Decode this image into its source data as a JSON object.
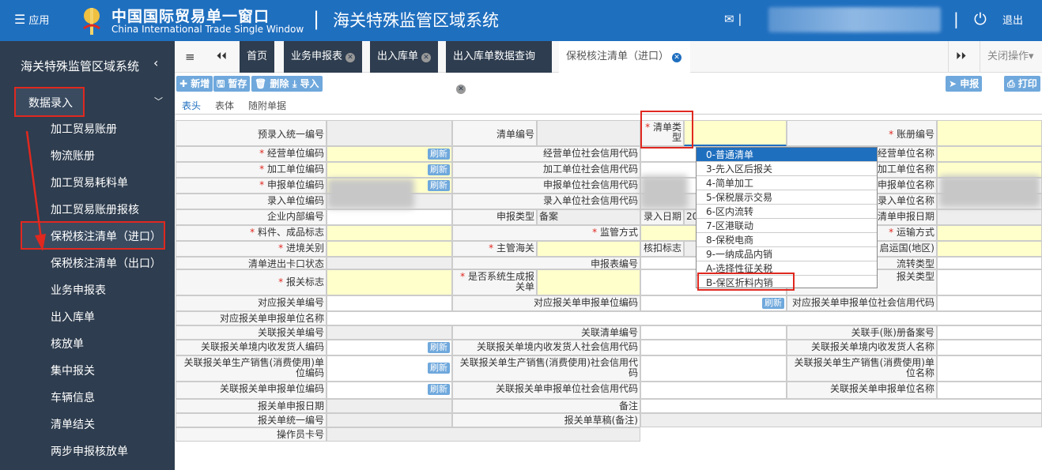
{
  "header": {
    "apps_label": "应用",
    "brand_cn": "中国国际贸易单一窗口",
    "brand_en": "China International Trade Single Window",
    "system_title": "海关特殊监管区域系统",
    "logout": "退出"
  },
  "sidebar": {
    "title": "海关特殊监管区域系统",
    "group": "数据录入",
    "items": [
      "加工贸易账册",
      "物流账册",
      "加工贸易耗料单",
      "加工贸易账册报核",
      "保税核注清单（进口）",
      "保税核注清单（出口）",
      "业务申报表",
      "出入库单",
      "核放单",
      "集中报关",
      "车辆信息",
      "清单结关",
      "两步申报核放单"
    ]
  },
  "tabs": [
    {
      "label": "首页"
    },
    {
      "label": "业务申报表"
    },
    {
      "label": "出入库单"
    },
    {
      "label": "出入库单数据查询"
    },
    {
      "label": "保税核注清单（进口）"
    }
  ],
  "tab_actions": "关闭操作",
  "toolbar": {
    "add": "新增",
    "save": "暂存",
    "delete": "删除",
    "import": "导入",
    "declare": "申报",
    "print": "打印"
  },
  "subtabs": [
    "表头",
    "表体",
    "随附单据"
  ],
  "form": {
    "refresh": "刷新",
    "labels": {
      "pre_entry_no": "预录入统一编号",
      "list_no": "清单编号",
      "list_type": "清单类型",
      "book_no": "账册编号",
      "op_code": "经营单位编码",
      "op_credit": "经营单位社会信用代码",
      "op_name": "经营单位名称",
      "proc_code": "加工单位编码",
      "proc_credit": "加工单位社会信用代码",
      "proc_name": "加工单位名称",
      "decl_code": "申报单位编码",
      "decl_credit": "申报单位社会信用代码",
      "decl_name": "申报单位名称",
      "entry_code": "录入单位编码",
      "entry_credit": "录入单位社会信用代码",
      "entry_name": "录入单位名称",
      "inner_no": "企业内部编号",
      "decl_type": "申报类型",
      "entry_date": "录入日期",
      "list_decl_date": "清单申报日期",
      "material_flag": "料件、成品标志",
      "supervision": "监管方式",
      "transport": "运输方式",
      "port": "进境关别",
      "customs": "主管海关",
      "deduct_flag": "核扣标志",
      "origin": "启运国(地区)",
      "gate_status": "清单进出卡口状态",
      "form_no": "申报表编号",
      "flow_type": "流转类型",
      "decl_flag": "报关标志",
      "sys_gen": "是否系统生成报关单",
      "decl_kind": "报关类型",
      "cd_no": "对应报关单编号",
      "cd_decl_code": "对应报关单申报单位编码",
      "cd_decl_credit": "对应报关单申报单位社会信用代码",
      "cd_decl_name": "对应报关单申报单位名称",
      "rel_cd_no": "关联报关单编号",
      "rel_list_no": "关联清单编号",
      "rel_book_no": "关联手(账)册备案号",
      "rel_recv_code": "关联报关单境内收发货人编码",
      "rel_recv_credit": "关联报关单境内收发货人社会信用代码",
      "rel_recv_name": "关联报关单境内收发货人名称",
      "rel_prod_code": "关联报关单生产销售(消费使用)单位编码",
      "rel_prod_credit": "关联报关单生产销售(消费使用)社会信用代码",
      "rel_prod_name": "关联报关单生产销售(消费使用)单位名称",
      "rel_decl_code": "关联报关单申报单位编码",
      "rel_decl_credit": "关联报关单申报单位社会信用代码",
      "rel_decl_name": "关联报关单申报单位名称",
      "cd_decl_date": "报关单申报日期",
      "remark": "备注",
      "cd_unified_no": "报关单统一编号",
      "cd_draft": "报关单草稿(备注)",
      "operator_card": "操作员卡号"
    },
    "values": {
      "decl_type": "备案",
      "entry_date_partial": "20"
    }
  },
  "dropdown": [
    "0-普通清单",
    "3-先入区后报关",
    "4-简单加工",
    "5-保税展示交易",
    "6-区内流转",
    "7-区港联动",
    "8-保税电商",
    "9-一纳成品内销",
    "A-选择性征关税",
    "B-保区折料内销"
  ]
}
